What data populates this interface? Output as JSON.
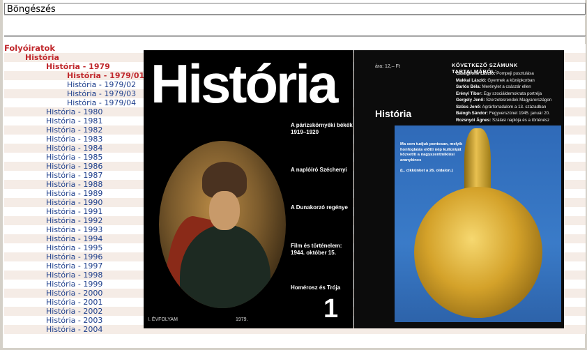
{
  "window": {
    "title": "Böngészés"
  },
  "tree": [
    {
      "label": "Folyóiratok",
      "level": "l0"
    },
    {
      "label": "História",
      "level": "l1"
    },
    {
      "label": "História - 1979",
      "level": "l2"
    },
    {
      "label": "História - 1979/01",
      "level": "l3"
    },
    {
      "label": "História - 1979/02",
      "level": "l3n"
    },
    {
      "label": "História - 1979/03",
      "level": "l3n"
    },
    {
      "label": "História - 1979/04",
      "level": "l3n"
    },
    {
      "label": "História - 1980",
      "level": "l2n"
    },
    {
      "label": "História - 1981",
      "level": "l2n"
    },
    {
      "label": "História - 1982",
      "level": "l2n"
    },
    {
      "label": "História - 1983",
      "level": "l2n"
    },
    {
      "label": "História - 1984",
      "level": "l2n"
    },
    {
      "label": "História - 1985",
      "level": "l2n"
    },
    {
      "label": "História - 1986",
      "level": "l2n"
    },
    {
      "label": "História - 1987",
      "level": "l2n"
    },
    {
      "label": "História - 1988",
      "level": "l2n"
    },
    {
      "label": "História - 1989",
      "level": "l2n"
    },
    {
      "label": "História - 1990",
      "level": "l2n"
    },
    {
      "label": "História - 1991",
      "level": "l2n"
    },
    {
      "label": "História - 1992",
      "level": "l2n"
    },
    {
      "label": "História - 1993",
      "level": "l2n"
    },
    {
      "label": "História - 1994",
      "level": "l2n"
    },
    {
      "label": "História - 1995",
      "level": "l2n"
    },
    {
      "label": "História - 1996",
      "level": "l2n"
    },
    {
      "label": "História - 1997",
      "level": "l2n"
    },
    {
      "label": "História - 1998",
      "level": "l2n"
    },
    {
      "label": "História - 1999",
      "level": "l2n"
    },
    {
      "label": "História - 2000",
      "level": "l2n"
    },
    {
      "label": "História - 2001",
      "level": "l2n"
    },
    {
      "label": "História - 2002",
      "level": "l2n"
    },
    {
      "label": "História - 2003",
      "level": "l2n"
    },
    {
      "label": "História - 2004",
      "level": "l2n"
    }
  ],
  "cover_left": {
    "masthead": "História",
    "headlines": [
      "A párizskörnyéki békék 1919–1920",
      "A naplóíró Széchenyi",
      "A Dunakorzó regénye",
      "Film és történelem: 1944. október 15.",
      "Homérosz és Trója"
    ],
    "issue_number": "1",
    "volume": "I. ÉVFOLYAM",
    "year": "1979."
  },
  "cover_right": {
    "price": "ára: 12,– Ft",
    "toc_title": "KÖVETKEZŐ SZÁMUNK TARTALMÁBÓL:",
    "toc": [
      {
        "author": "Castiglione László:",
        "title": "Pompeji pusztulása"
      },
      {
        "author": "Makkai László:",
        "title": "Gyermek a középkorban"
      },
      {
        "author": "Sarlós Béla:",
        "title": "Merénylet a császár ellen"
      },
      {
        "author": "Erényi Tibor:",
        "title": "Egy szociáldemokrata portréja"
      },
      {
        "author": "Gergely Jenő:",
        "title": "Szerzetesrendek Magyarországon"
      },
      {
        "author": "Szűcs Jenő:",
        "title": "Agrárforradalom a 13. században"
      },
      {
        "author": "Balogh Sándor:",
        "title": "Fegyverszünet 1945. január 20."
      },
      {
        "author": "Rozsnyói Ágnes:",
        "title": "Szálasi naplója és a történész"
      }
    ],
    "masthead": "História",
    "caption": "Ma sem tudjuk pontosan, melyik honfoglalás előtti nép kultúráját közvetíti a nagyszentmiklósi aranykincs",
    "caption_ref": "(L. cikkünket a 26. oldalon.)"
  }
}
